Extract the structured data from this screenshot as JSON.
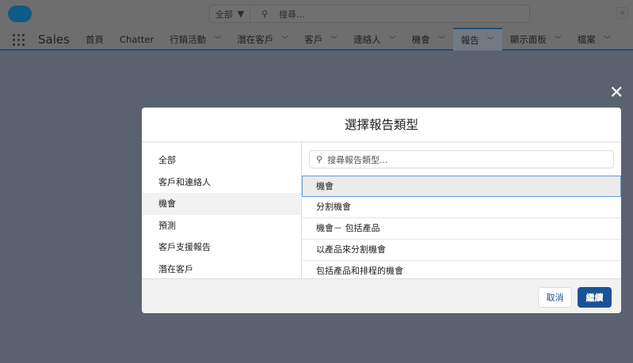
{
  "header": {
    "search_scope": "全部",
    "search_placeholder": "搜尋...",
    "app_name": "Sales"
  },
  "nav": {
    "tabs": [
      {
        "label": "首頁",
        "dropdown": false
      },
      {
        "label": "Chatter",
        "dropdown": false
      },
      {
        "label": "行銷活動",
        "dropdown": true
      },
      {
        "label": "潛在客戶",
        "dropdown": true
      },
      {
        "label": "客戶",
        "dropdown": true
      },
      {
        "label": "連絡人",
        "dropdown": true
      },
      {
        "label": "機會",
        "dropdown": true
      },
      {
        "label": "報告",
        "dropdown": true,
        "active": true
      },
      {
        "label": "顯示面板",
        "dropdown": true
      },
      {
        "label": "檔案",
        "dropdown": true
      }
    ]
  },
  "modal": {
    "title": "選擇報告類型",
    "categories": [
      "全部",
      "客戶和連絡人",
      "機會",
      "預測",
      "客戶支援報告",
      "潛在客戶"
    ],
    "selected_category": "機會",
    "search_placeholder": "搜尋報告類型...",
    "report_types": [
      "機會",
      "分割機會",
      "機會－ 包括產品",
      "以產品來分割機會",
      "包括產品和排程的機會"
    ],
    "selected_report_type": "機會",
    "cancel_label": "取消",
    "continue_label": "繼續"
  },
  "colors": {
    "brand": "#1b5297",
    "overlay": "#5a6270"
  }
}
